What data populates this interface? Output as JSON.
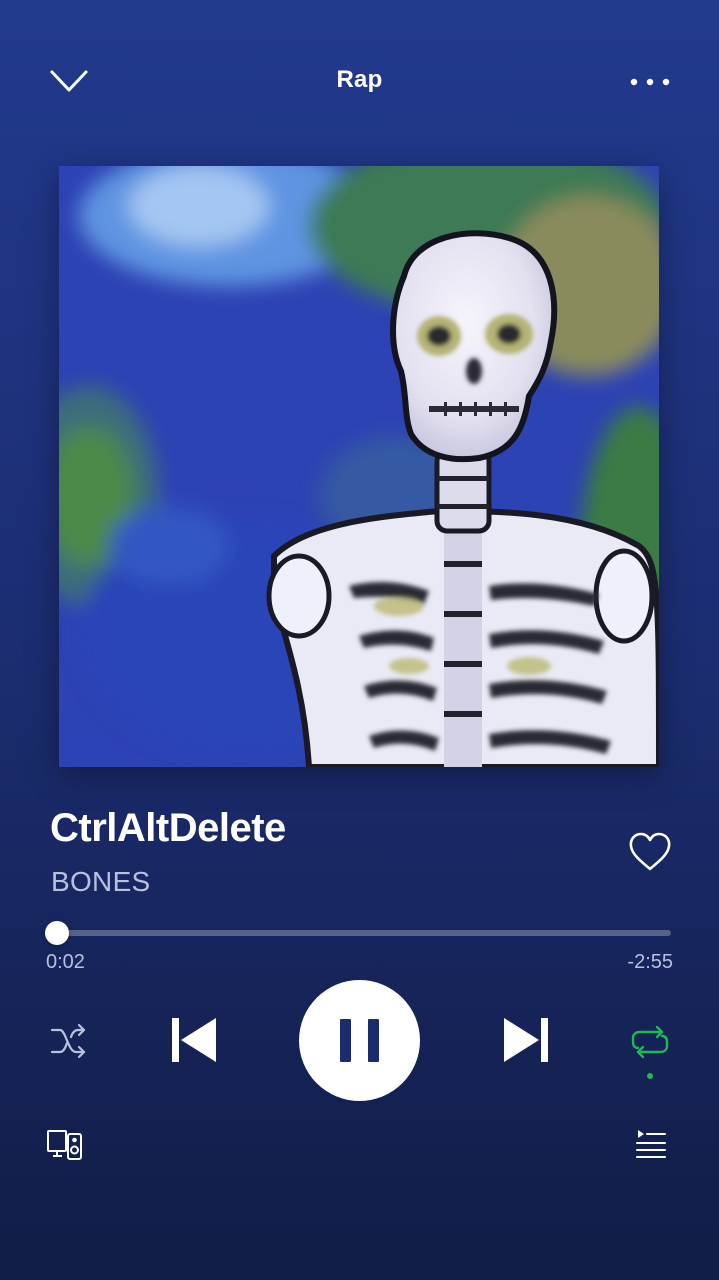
{
  "header": {
    "context_title": "Rap"
  },
  "track": {
    "title": "CtrlAltDelete",
    "artist": "BONES",
    "liked": false
  },
  "playback": {
    "elapsed": "0:02",
    "remaining": "-2:55",
    "progress_fraction": 0.0114,
    "is_playing": true,
    "shuffle": false,
    "repeat": true
  },
  "icons": {
    "collapse": "chevron-down-icon",
    "more": "more-dots-icon",
    "like": "heart-icon",
    "shuffle": "shuffle-icon",
    "previous": "skip-previous-icon",
    "pause": "pause-icon",
    "next": "skip-next-icon",
    "repeat": "repeat-icon",
    "devices": "devices-icon",
    "queue": "queue-icon"
  },
  "colors": {
    "accent": "#1db954",
    "secondary_text": "#b9c0df",
    "background_top": "#223a8e",
    "background_bottom": "#111d47"
  }
}
